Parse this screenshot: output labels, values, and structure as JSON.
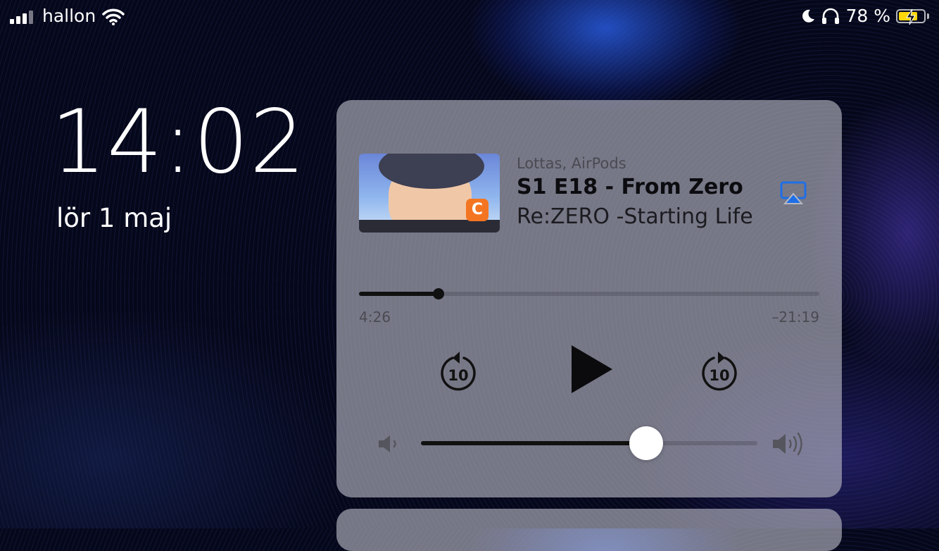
{
  "status_bar": {
    "carrier": "hallon",
    "battery_text": "78 %",
    "battery_level": 0.78,
    "icons": [
      "signal-icon",
      "wifi-icon",
      "moon-icon",
      "headphones-icon",
      "battery-charging-icon"
    ],
    "battery_color": "#ffd60a"
  },
  "lock_screen": {
    "time": "14:02",
    "date": "lör 1 maj"
  },
  "player": {
    "source": "Lottas, AirPods",
    "title": "S1 E18 - From Zero",
    "subtitle": "Re:ZERO -Starting Life",
    "elapsed": "4:26",
    "remaining": "–21:19",
    "progress": 0.173,
    "volume": 0.67,
    "skip_back_seconds": "10",
    "skip_forward_seconds": "10",
    "accent_color": "#1e6fe6",
    "app_badge_color": "#f47521"
  }
}
